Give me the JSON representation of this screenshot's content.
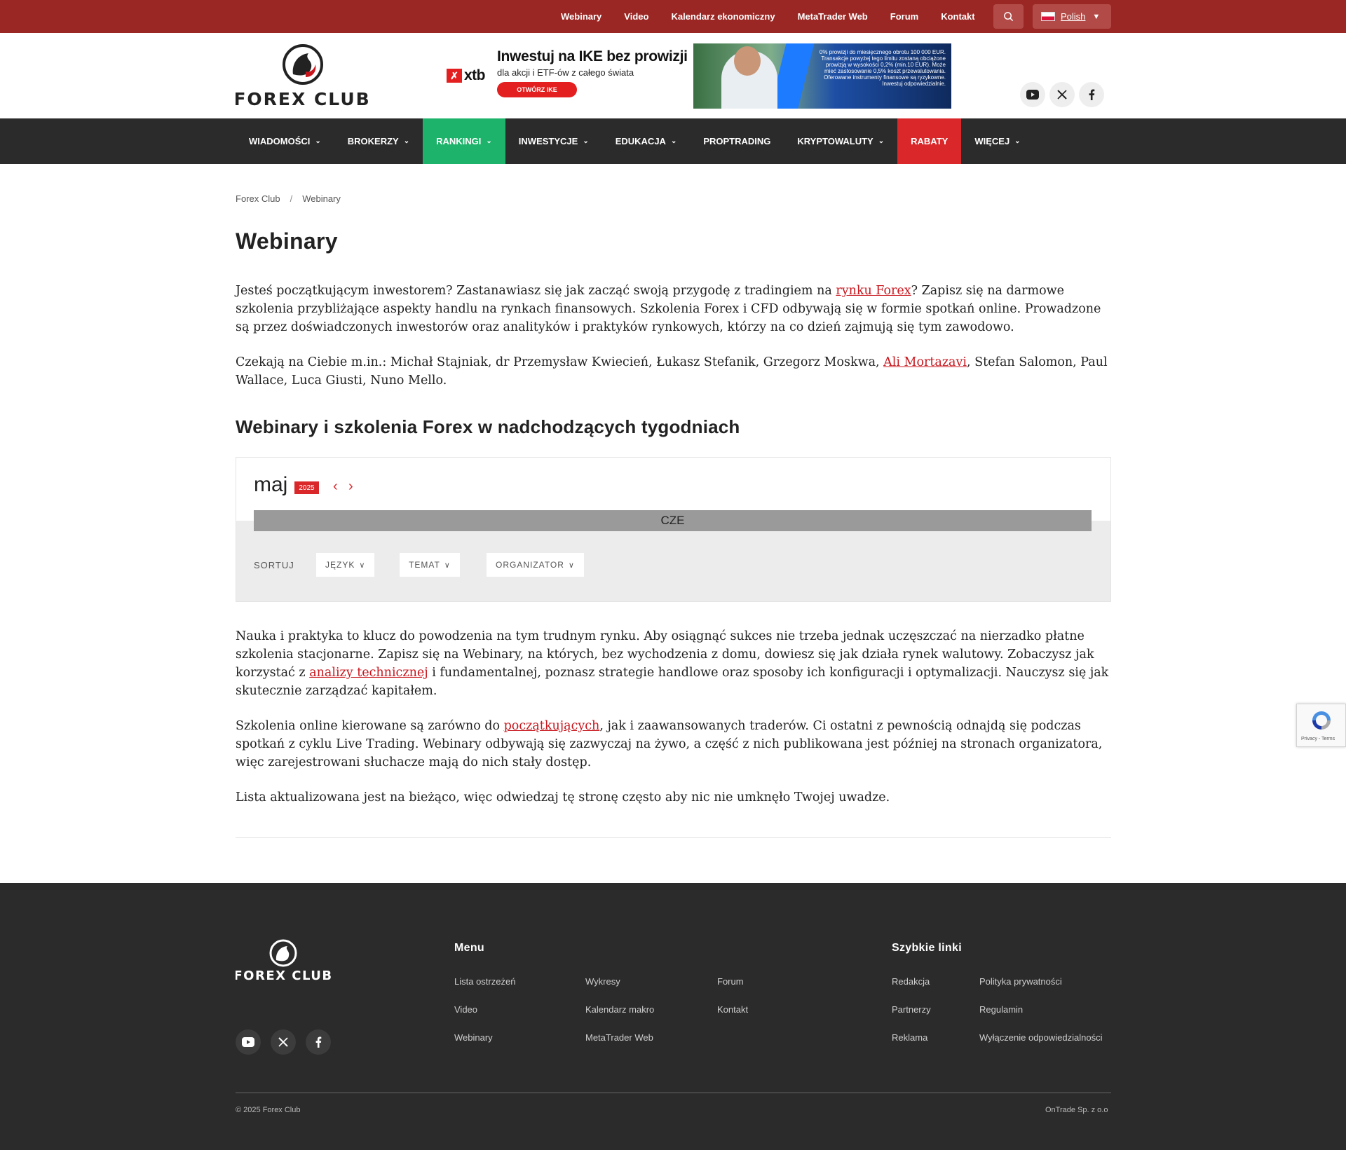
{
  "topbar": {
    "links": [
      "Webinary",
      "Video",
      "Kalendarz ekonomiczny",
      "MetaTrader Web",
      "Forum",
      "Kontakt"
    ],
    "language": "Polish",
    "search_icon": "search-icon"
  },
  "header": {
    "logo_text": "FOREX CLUB",
    "ad": {
      "brand": "xtb",
      "headline": "Inwestuj na IKE bez prowizji",
      "subline": "dla akcji i ETF-ów z całego świata",
      "cta": "OTWÓRZ IKE",
      "disclaimer": "0% prowizji do miesięcznego obrotu 100 000 EUR. Transakcje powyżej tego limitu zostaną obciążone prowizją w wysokości 0,2% (min.10 EUR). Może mieć zastosowanie 0,5% koszt przewalutowania. Oferowane instrumenty finansowe są ryzykowne. Inwestuj odpowiedzialnie."
    },
    "social_icons": [
      "youtube-icon",
      "x-icon",
      "facebook-icon"
    ]
  },
  "nav": {
    "items": [
      {
        "label": "WIADOMOŚCI",
        "dropdown": true,
        "style": "default"
      },
      {
        "label": "BROKERZY",
        "dropdown": true,
        "style": "default"
      },
      {
        "label": "RANKINGI",
        "dropdown": true,
        "style": "green"
      },
      {
        "label": "INWESTYCJE",
        "dropdown": true,
        "style": "default"
      },
      {
        "label": "EDUKACJA",
        "dropdown": true,
        "style": "default"
      },
      {
        "label": "PROPTRADING",
        "dropdown": false,
        "style": "default"
      },
      {
        "label": "KRYPTOWALUTY",
        "dropdown": true,
        "style": "default"
      },
      {
        "label": "RABATY",
        "dropdown": false,
        "style": "red"
      },
      {
        "label": "WIĘCEJ",
        "dropdown": true,
        "style": "default"
      }
    ],
    "accent_green": "#1db36a",
    "accent_red": "#d9272a"
  },
  "breadcrumb": {
    "home": "Forex Club",
    "separator": "/",
    "current": "Webinary"
  },
  "main": {
    "title": "Webinary",
    "intro_1": {
      "before": "Jesteś początkującym inwestorem? Zastanawiasz się jak zacząć swoją przygodę z tradingiem na ",
      "link": "rynku Forex",
      "after": "? Zapisz się na darmowe szkolenia przybliżające aspekty handlu na rynkach finansowych. Szkolenia Forex i CFD odbywają się w formie spotkań online. Prowadzone są przez doświadczonych inwestorów oraz analityków i praktyków rynkowych, którzy na co dzień zajmują się tym zawodowo."
    },
    "intro_2": {
      "before": "Czekają na Ciebie m.in.: Michał Stajniak, dr Przemysław Kwiecień, Łukasz Stefanik, Grzegorz Moskwa, ",
      "link": "Ali Mortazavi",
      "after": ", Stefan Salomon, Paul Wallace, Luca Giusti, Nuno Mello."
    },
    "subheading": "Webinary i szkolenia Forex w nadchodzących tygodniach",
    "calendar": {
      "month": "maj",
      "year": "2025",
      "day_header": "CZE",
      "sort_label": "SORTUJ",
      "filters": [
        "JĘZYK",
        "TEMAT",
        "ORGANIZATOR"
      ]
    },
    "body_1": {
      "before": "Nauka i praktyka to klucz do powodzenia na tym trudnym rynku. Aby osiągnąć sukces nie trzeba jednak uczęszczać na nierzadko płatne szkolenia stacjonarne. Zapisz się na Webinary, na których, bez wychodzenia z domu, dowiesz się jak działa rynek walutowy. Zobaczysz jak korzystać z ",
      "link": "analizy technicznej",
      "after": " i fundamentalnej, poznasz strategie handlowe oraz sposoby ich konfiguracji i optymalizacji. Nauczysz się jak skutecznie zarządzać kapitałem."
    },
    "body_2": {
      "before": "Szkolenia online kierowane są zarówno do ",
      "link": "początkujących",
      "after": ", jak i zaawansowanych traderów. Ci ostatni z pewnością odnajdą się podczas spotkań z cyklu Live Trading. Webinary odbywają się zazwyczaj na żywo, a część z nich publikowana jest później na stronach organizatora, więc zarejestrowani słuchacze mają do nich stały dostęp."
    },
    "body_3": "Lista aktualizowana jest na bieżąco, więc odwiedzaj tę stronę często aby nic nie umknęło Twojej uwadze."
  },
  "recaptcha": {
    "text": "Privacy - Terms"
  },
  "footer": {
    "logo_text": "FOREX CLUB",
    "menu_heading": "Menu",
    "menu_col1": [
      "Lista ostrzeżeń",
      "Video",
      "Webinary"
    ],
    "menu_col2": [
      "Wykresy",
      "Kalendarz makro",
      "MetaTrader Web"
    ],
    "menu_col3": [
      "Forum",
      "Kontakt"
    ],
    "quick_heading": "Szybkie linki",
    "quick_col1": [
      "Redakcja",
      "Partnerzy",
      "Reklama"
    ],
    "quick_col2": [
      "Polityka prywatności",
      "Regulamin",
      "Wyłączenie odpowiedzialności"
    ],
    "copyright": "© 2025 Forex Club",
    "company": "OnTrade Sp. z o.o"
  }
}
